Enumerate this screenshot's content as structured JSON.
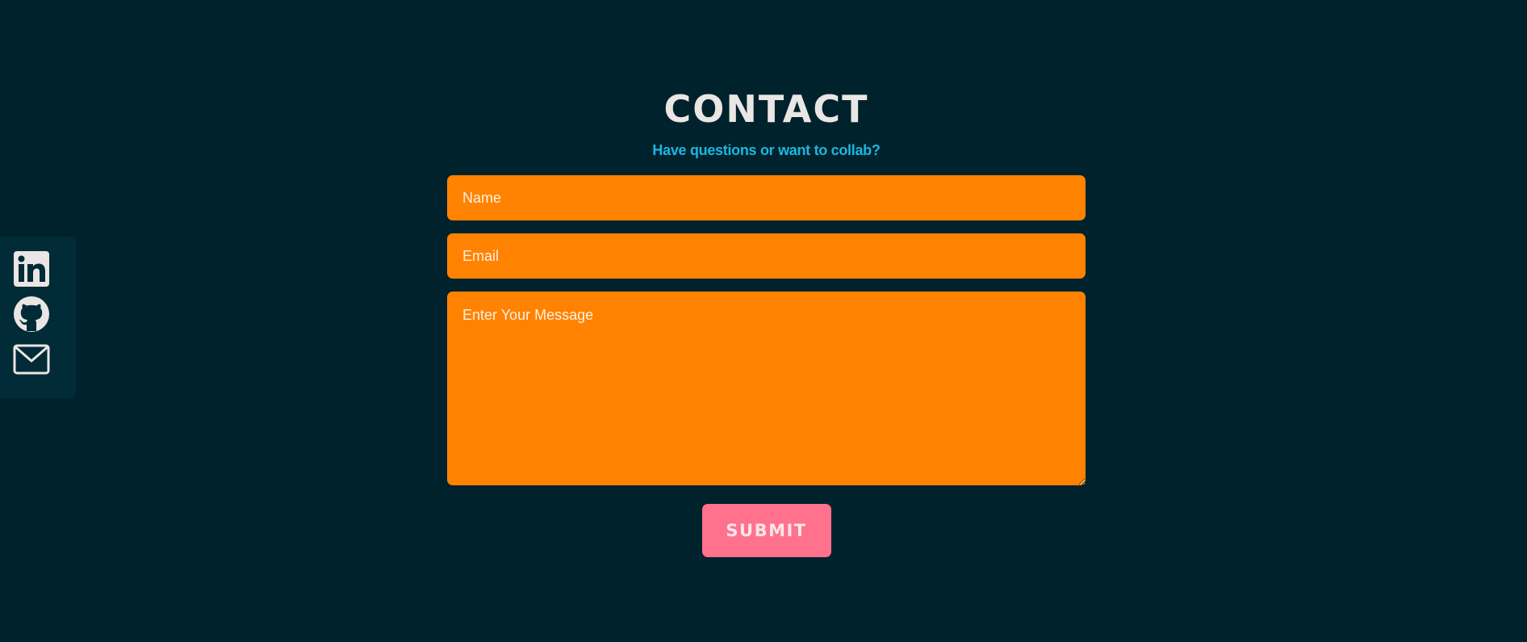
{
  "colors": {
    "background": "#00222c",
    "social_bar": "#012b37",
    "title": "#eae6e3",
    "subtitle": "#1bb7e0",
    "field_background": "#ff8200",
    "submit_background": "#ff718c",
    "icon": "#eae6e3"
  },
  "social": {
    "items": [
      {
        "icon": "linkedin-icon"
      },
      {
        "icon": "github-icon"
      },
      {
        "icon": "mail-icon"
      }
    ]
  },
  "contact": {
    "title": "CONTACT",
    "subtitle": "Have questions or want to collab?",
    "form": {
      "name_placeholder": "Name",
      "name_value": "",
      "email_placeholder": "Email",
      "email_value": "",
      "message_placeholder": "Enter Your Message",
      "message_value": "",
      "submit_label": "SUBMIT"
    }
  }
}
